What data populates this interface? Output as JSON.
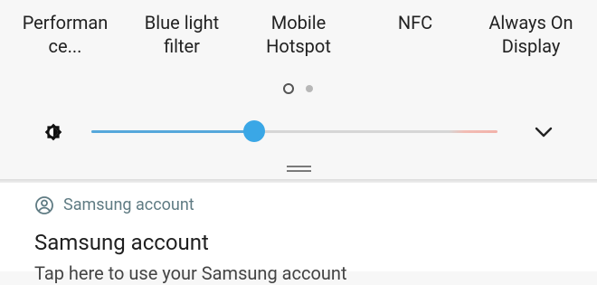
{
  "quick_settings": {
    "tiles": [
      {
        "line1": "Performan",
        "line2": "ce..."
      },
      {
        "line1": "Blue light",
        "line2": "filter"
      },
      {
        "line1": "Mobile",
        "line2": "Hotspot"
      },
      {
        "line1": "NFC",
        "line2": ""
      },
      {
        "line1": "Always On",
        "line2": "Display"
      }
    ],
    "page_indicator": {
      "pages": 2,
      "current": 1
    }
  },
  "brightness": {
    "level": 0.4,
    "icon": "brightness-icon",
    "expand_icon": "chevron-down-icon"
  },
  "notification": {
    "app_name": "Samsung account",
    "app_icon": "account-circle-icon",
    "title": "Samsung account",
    "body": "Tap here to use your Samsung account"
  },
  "colors": {
    "accent": "#3aa7e6",
    "panel_bg": "#f7f7f7",
    "app_name": "#5f7b83"
  }
}
